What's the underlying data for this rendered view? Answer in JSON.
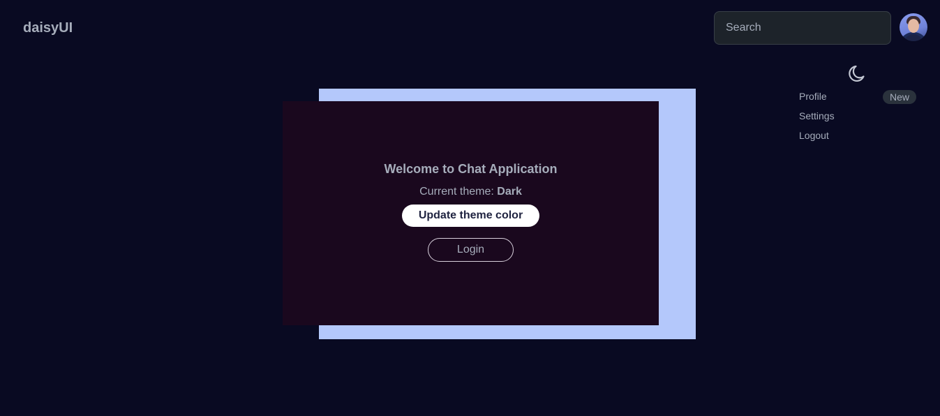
{
  "navbar": {
    "brand": "daisyUI",
    "search": {
      "placeholder": "Search",
      "value": ""
    },
    "avatar_icon": "user-avatar"
  },
  "theme_toggle": {
    "icon": "moon-icon"
  },
  "dropdown_menu": {
    "items": [
      {
        "label": "Profile",
        "badge": "New"
      },
      {
        "label": "Settings"
      },
      {
        "label": "Logout"
      }
    ]
  },
  "card": {
    "title": "Welcome to Chat Application",
    "theme_prefix": "Current theme: ",
    "theme_value": "Dark",
    "update_button": "Update theme color",
    "login_button": "Login"
  },
  "colors": {
    "page_background": "#090a22",
    "card_background": "#1a081e",
    "backdrop_panel": "#b4c8fb",
    "text": "#a6adbb"
  }
}
